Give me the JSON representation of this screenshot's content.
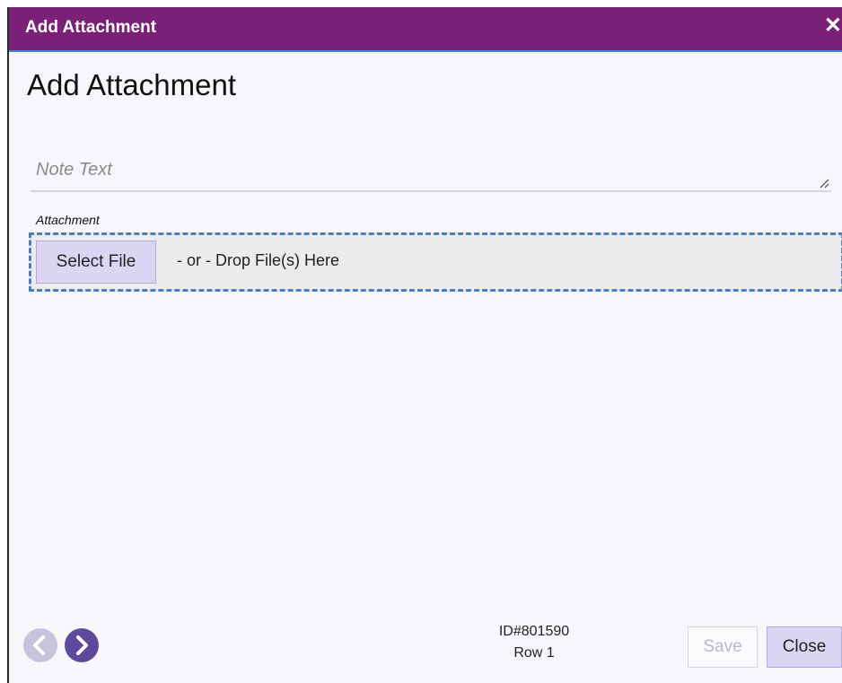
{
  "dialog": {
    "title": "Add Attachment",
    "heading": "Add Attachment",
    "title_bar_color": "#7b2077"
  },
  "note": {
    "placeholder": "Note Text",
    "value": ""
  },
  "attachment": {
    "label": "Attachment",
    "select_button": "Select File",
    "drop_text": "- or - Drop File(s) Here"
  },
  "footer": {
    "record_id": "ID#801590",
    "row": "Row 1",
    "save_label": "Save",
    "close_label": "Close",
    "prev_icon": "chevron-left-circle",
    "next_icon": "chevron-right-circle"
  }
}
